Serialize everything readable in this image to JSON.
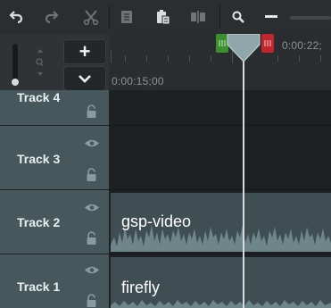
{
  "toolbar": {
    "icons": [
      "undo-icon",
      "redo-icon",
      "cut-icon",
      "copy-icon",
      "paste-icon",
      "split-icon",
      "zoom-icon",
      "zoom-out-icon"
    ]
  },
  "timeline_controls": {
    "add_track_label": "+",
    "collapse_label": "⌄"
  },
  "ruler": {
    "time_left": "0:00:15;00",
    "time_right": "0:00:22;"
  },
  "tracks": [
    {
      "name": "Track 4",
      "clip": ""
    },
    {
      "name": "Track 3",
      "clip": ""
    },
    {
      "name": "Track 2",
      "clip": "gsp-video"
    },
    {
      "name": "Track 1",
      "clip": "firefly"
    }
  ],
  "colors": {
    "track_header": "#46585c",
    "clip": "#3e4e52",
    "marker_in": "#3b8f2f",
    "marker_out": "#c0262b",
    "playhead": "#d8dbdc",
    "playhead_cap": "#8fa7ab"
  }
}
